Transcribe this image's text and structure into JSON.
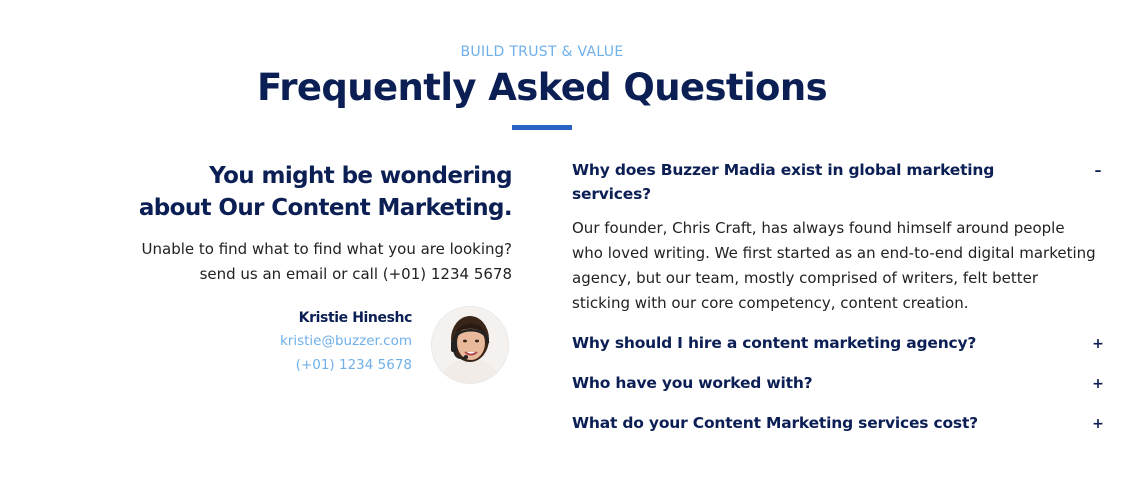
{
  "header": {
    "eyebrow": "BUILD TRUST & VALUE",
    "title": "Frequently Asked Questions"
  },
  "intro": {
    "heading_line1": "You might be wondering",
    "heading_line2": "about Our Content Marketing.",
    "text_line1": "Unable to find what to find what you are looking?",
    "text_line2": "send us an email or call (+01) 1234 5678"
  },
  "contact": {
    "name": "Kristie Hineshc",
    "email": "kristie@buzzer.com",
    "phone": "(+01) 1234 5678"
  },
  "faq": [
    {
      "question": "Why does Buzzer Madia exist in global marketing services?",
      "answer": "Our founder, Chris Craft, has always found himself around people who loved writing. We first started as an end-to-end digital marketing agency, but our team, mostly comprised of writers, felt better sticking with our core competency, content creation.",
      "toggle": "–",
      "open": true
    },
    {
      "question": "Why should I hire a content marketing agency?",
      "answer": "",
      "toggle": "+",
      "open": false
    },
    {
      "question": "Who have you worked with?",
      "answer": "",
      "toggle": "+",
      "open": false
    },
    {
      "question": "What do your Content Marketing services cost?",
      "answer": "",
      "toggle": "+",
      "open": false
    }
  ],
  "colors": {
    "navy": "#0b1f55",
    "accent": "#2a63c4",
    "link": "#6fb0ea"
  }
}
